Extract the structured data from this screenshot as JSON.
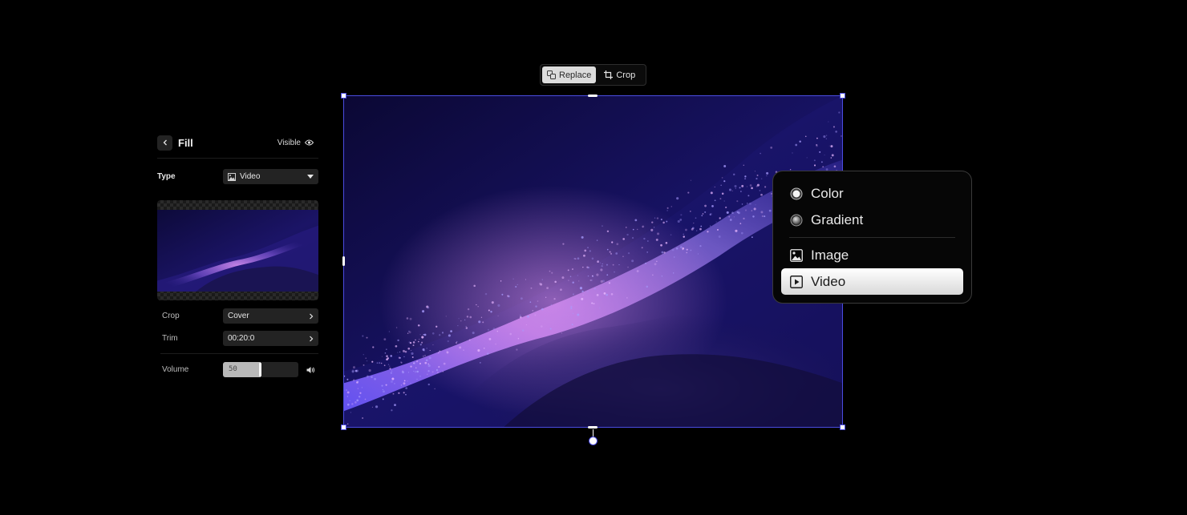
{
  "toolbar": {
    "replace_label": "Replace",
    "crop_label": "Crop"
  },
  "fill_panel": {
    "title": "Fill",
    "visibility_label": "Visible",
    "type": {
      "label": "Type",
      "value": "Video"
    },
    "crop": {
      "label": "Crop",
      "value": "Cover"
    },
    "trim": {
      "label": "Trim",
      "value": "00:20:0"
    },
    "volume": {
      "label": "Volume",
      "value": "50",
      "level": 0.5
    }
  },
  "fill_type_menu": {
    "items": [
      {
        "label": "Color",
        "icon": "radio-filled-icon"
      },
      {
        "label": "Gradient",
        "icon": "gradient-circle-icon"
      },
      {
        "label": "Image",
        "icon": "image-icon"
      },
      {
        "label": "Video",
        "icon": "play-box-icon",
        "selected": true
      }
    ]
  },
  "colors": {
    "selection_accent": "#4a4ce0",
    "panel_bg": "#000000",
    "control_bg": "#232323",
    "menu_selected_bg": "#f0f0f0"
  }
}
